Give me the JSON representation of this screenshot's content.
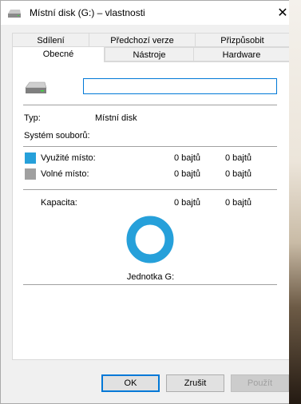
{
  "window": {
    "title": "Místní disk (G:) – vlastnosti",
    "close_symbol": "✕"
  },
  "tabs": {
    "row1": [
      "Sdílení",
      "Předchozí verze",
      "Přizpůsobit"
    ],
    "row2": [
      "Obecné",
      "Nástroje",
      "Hardware"
    ],
    "active": "Obecné"
  },
  "general": {
    "name_value": "",
    "type_label": "Typ:",
    "type_value": "Místní disk",
    "fs_label": "Systém souborů:",
    "fs_value": "",
    "used_label": "Využité místo:",
    "used_bytes": "0 bajtů",
    "used_size": "0 bajtů",
    "free_label": "Volné místo:",
    "free_bytes": "0 bajtů",
    "free_size": "0 bajtů",
    "capacity_label": "Kapacita:",
    "capacity_bytes": "0 bajtů",
    "capacity_size": "0 bajtů",
    "drive_label": "Jednotka G:"
  },
  "colors": {
    "used": "#26a0da",
    "free": "#a0a0a0",
    "accent": "#0078d7"
  },
  "usage": {
    "used_fraction": 0
  },
  "buttons": {
    "ok": "OK",
    "cancel": "Zrušit",
    "apply": "Použít"
  }
}
